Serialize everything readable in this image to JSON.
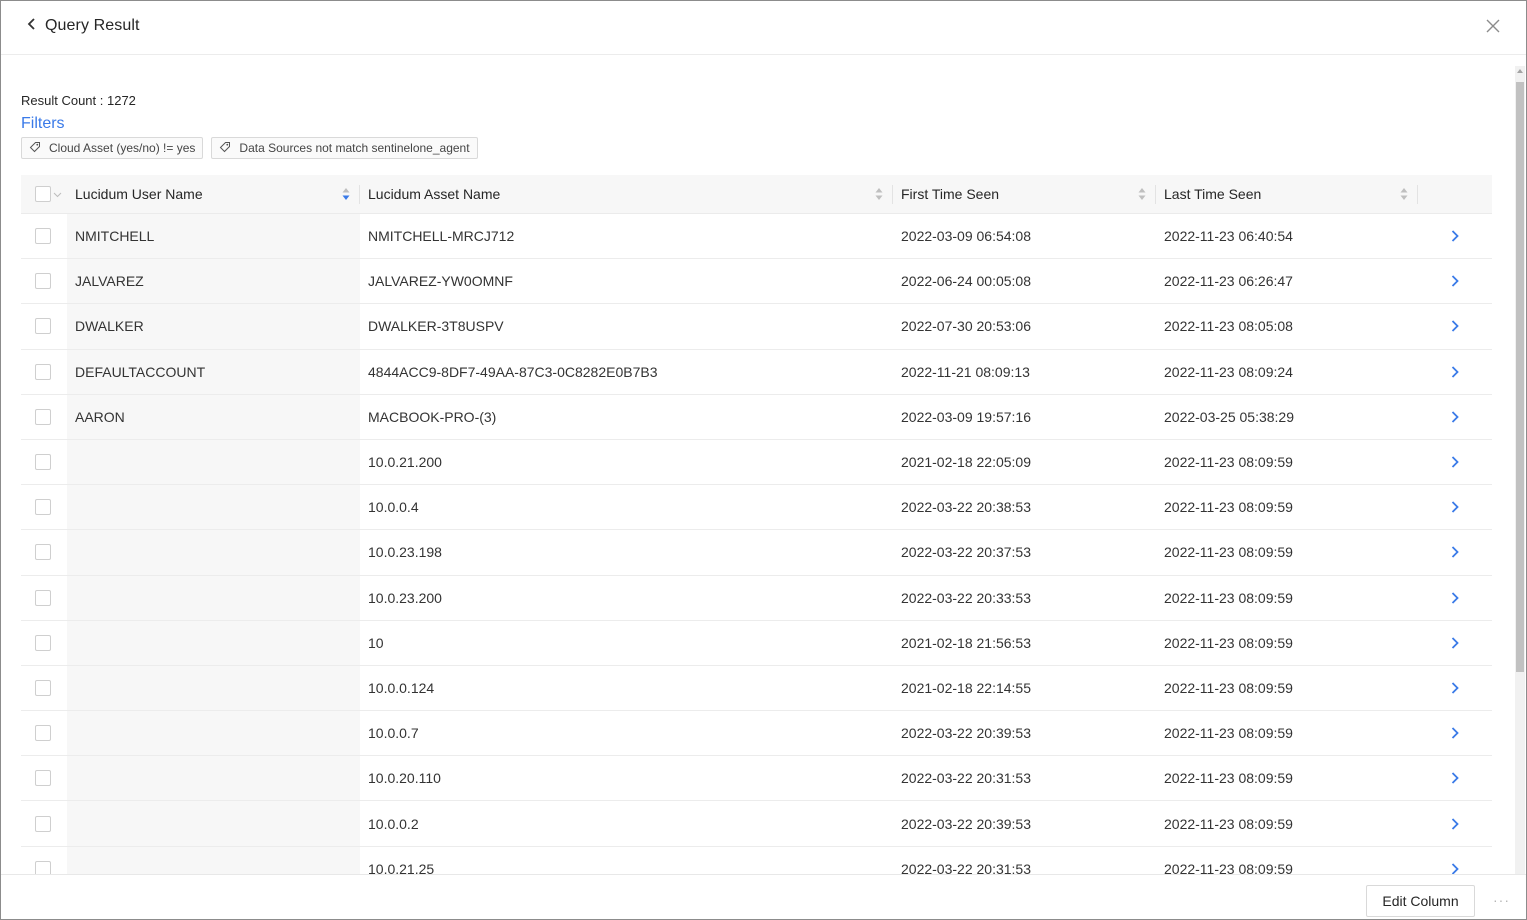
{
  "header": {
    "title": "Query Result"
  },
  "summary": {
    "result_count": "Result Count : 1272",
    "filters_label": "Filters",
    "filters": [
      "Cloud Asset (yes/no) != yes",
      "Data Sources not match sentinelone_agent"
    ]
  },
  "table": {
    "columns": {
      "user": "Lucidum User Name",
      "asset": "Lucidum Asset Name",
      "first": "First Time Seen",
      "last": "Last Time Seen"
    },
    "rows": [
      {
        "user": "NMITCHELL",
        "asset": "NMITCHELL-MRCJ712",
        "first": "2022-03-09 06:54:08",
        "last": "2022-11-23 06:40:54"
      },
      {
        "user": "JALVAREZ",
        "asset": "JALVAREZ-YW0OMNF",
        "first": "2022-06-24 00:05:08",
        "last": "2022-11-23 06:26:47"
      },
      {
        "user": "DWALKER",
        "asset": "DWALKER-3T8USPV",
        "first": "2022-07-30 20:53:06",
        "last": "2022-11-23 08:05:08"
      },
      {
        "user": "DEFAULTACCOUNT",
        "asset": "4844ACC9-8DF7-49AA-87C3-0C8282E0B7B3",
        "first": "2022-11-21 08:09:13",
        "last": "2022-11-23 08:09:24"
      },
      {
        "user": "AARON",
        "asset": "MACBOOK-PRO-(3)",
        "first": "2022-03-09 19:57:16",
        "last": "2022-03-25 05:38:29"
      },
      {
        "user": "",
        "asset": "10.0.21.200",
        "first": "2021-02-18 22:05:09",
        "last": "2022-11-23 08:09:59"
      },
      {
        "user": "",
        "asset": "10.0.0.4",
        "first": "2022-03-22 20:38:53",
        "last": "2022-11-23 08:09:59"
      },
      {
        "user": "",
        "asset": "10.0.23.198",
        "first": "2022-03-22 20:37:53",
        "last": "2022-11-23 08:09:59"
      },
      {
        "user": "",
        "asset": "10.0.23.200",
        "first": "2022-03-22 20:33:53",
        "last": "2022-11-23 08:09:59"
      },
      {
        "user": "",
        "asset": "10",
        "first": "2021-02-18 21:56:53",
        "last": "2022-11-23 08:09:59"
      },
      {
        "user": "",
        "asset": "10.0.0.124",
        "first": "2021-02-18 22:14:55",
        "last": "2022-11-23 08:09:59"
      },
      {
        "user": "",
        "asset": "10.0.0.7",
        "first": "2022-03-22 20:39:53",
        "last": "2022-11-23 08:09:59"
      },
      {
        "user": "",
        "asset": "10.0.20.110",
        "first": "2022-03-22 20:31:53",
        "last": "2022-11-23 08:09:59"
      },
      {
        "user": "",
        "asset": "10.0.0.2",
        "first": "2022-03-22 20:39:53",
        "last": "2022-11-23 08:09:59"
      },
      {
        "user": "",
        "asset": "10.0.21.25",
        "first": "2022-03-22 20:31:53",
        "last": "2022-11-23 08:09:59"
      }
    ]
  },
  "footer": {
    "edit_column_label": "Edit Column",
    "more_label": "···"
  },
  "colors": {
    "accent": "#3a7ae8",
    "header_bg": "#f7f7f7"
  },
  "icons": {
    "back": "chevron-left-icon",
    "close": "close-icon",
    "tag": "tag-icon",
    "sort": "sort-icon",
    "row_open": "chevron-right-icon"
  }
}
